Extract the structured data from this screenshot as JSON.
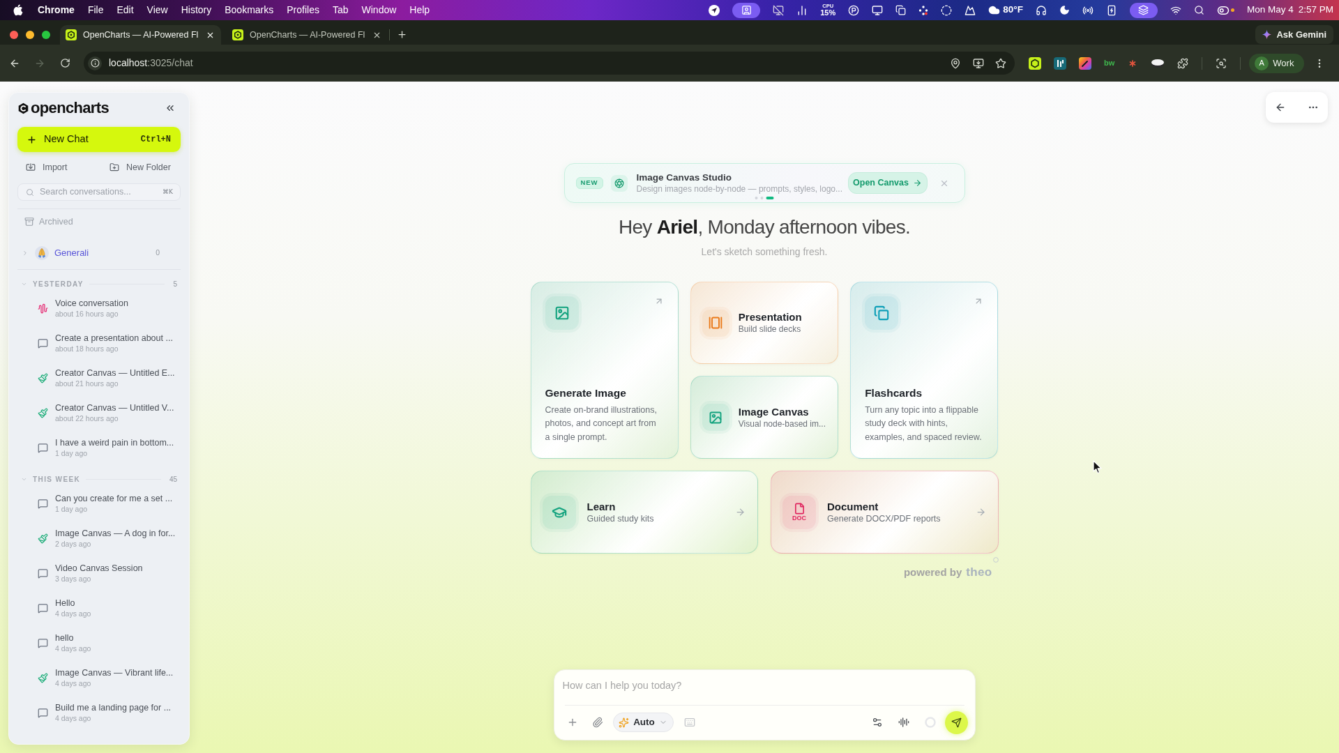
{
  "menu_bar": {
    "app": "Chrome",
    "menus": [
      "File",
      "Edit",
      "View",
      "History",
      "Bookmarks",
      "Profiles",
      "Tab",
      "Window",
      "Help"
    ],
    "cpu_label": "CPU",
    "cpu_value": "15%",
    "weather": "80°F",
    "date": "Mon May 4",
    "time": "2:57 PM"
  },
  "browser": {
    "tabs": [
      {
        "title": "OpenCharts — AI-Powered Fl",
        "selected": true
      },
      {
        "title": "OpenCharts — AI-Powered Fl",
        "selected": false
      }
    ],
    "ask_button": "Ask Gemini",
    "forward_disabled": true,
    "url": {
      "host": "localhost",
      "path": ":3025/chat"
    },
    "extension_label": "bw",
    "profile_initial": "A",
    "profile_name": "Work"
  },
  "sidebar": {
    "logo": "opencharts",
    "new_chat": {
      "label": "New Chat",
      "shortcut": "Ctrl+N"
    },
    "actions": [
      "Import",
      "New Folder"
    ],
    "search": {
      "placeholder": "Search conversations...",
      "shortcut": "⌘K"
    },
    "archived": "Archived",
    "folders": [
      {
        "name": "Generali",
        "count": "0",
        "expanded": false
      }
    ],
    "sections": [
      {
        "title": "YESTERDAY",
        "count": "5",
        "expanded": true,
        "items": [
          {
            "kind": "voice",
            "title": "Voice conversation",
            "time": "about 16 hours ago"
          },
          {
            "kind": "chat",
            "title": "Create a presentation about ...",
            "time": "about 18 hours ago"
          },
          {
            "kind": "canvas",
            "title": "Creator Canvas — Untitled E...",
            "time": "about 21 hours ago"
          },
          {
            "kind": "canvas",
            "title": "Creator Canvas — Untitled V...",
            "time": "about 22 hours ago"
          },
          {
            "kind": "chat",
            "title": "I have a weird pain in bottom...",
            "time": "1 day ago"
          }
        ]
      },
      {
        "title": "THIS WEEK",
        "count": "45",
        "expanded": true,
        "items": [
          {
            "kind": "chat",
            "title": "Can you create for me a set ...",
            "time": "1 day ago"
          },
          {
            "kind": "canvas",
            "title": "Image Canvas — A dog in for...",
            "time": "2 days ago"
          },
          {
            "kind": "chat",
            "title": "Video Canvas Session",
            "time": "3 days ago"
          },
          {
            "kind": "chat",
            "title": "Hello",
            "time": "4 days ago"
          },
          {
            "kind": "chat",
            "title": "hello",
            "time": "4 days ago"
          },
          {
            "kind": "canvas",
            "title": "Image Canvas — Vibrant life...",
            "time": "4 days ago"
          },
          {
            "kind": "chat",
            "title": "Build me a landing page for ...",
            "time": "4 days ago"
          }
        ]
      }
    ]
  },
  "announcement": {
    "badge": "NEW",
    "title": "Image Canvas Studio",
    "description": "Design images node-by-node — prompts, styles, logo...",
    "action": "Open Canvas",
    "pager": [
      {
        "selected": false
      },
      {
        "selected": false
      },
      {
        "selected": true
      }
    ]
  },
  "greeting": "Hey **Ariel**, Monday afternoon vibes.",
  "subtitle": "Let's sketch something fresh.",
  "cards": [
    {
      "kind": "tall",
      "title": "Generate Image",
      "description": "Create on-brand illustrations,\nphotos, and concept art from\na single prompt.",
      "color": "#14a37f"
    },
    {
      "kind": "compact",
      "title": "Presentation",
      "description": "Build slide decks",
      "color": "#ea7a1a"
    },
    {
      "kind": "compact",
      "title": "Image Canvas",
      "description": "Visual node-based im...",
      "color": "#14a37f"
    },
    {
      "kind": "tall",
      "title": "Flashcards",
      "description": "Turn any topic into a flippable\nstudy deck with hints,\nexamples, and spaced review.",
      "color": "#0e9fb8"
    },
    {
      "kind": "wide",
      "title": "Learn",
      "description": "Guided study kits",
      "color": "#14a37f"
    },
    {
      "kind": "wide",
      "title": "Document",
      "description": "Generate DOCX/PDF reports",
      "color": "#e0245e",
      "icon_label": "DOC"
    }
  ],
  "powered_by": {
    "prefix": "powered by",
    "brand": "theo"
  },
  "composer": {
    "placeholder": "How can I help you today?",
    "mode": "Auto"
  }
}
